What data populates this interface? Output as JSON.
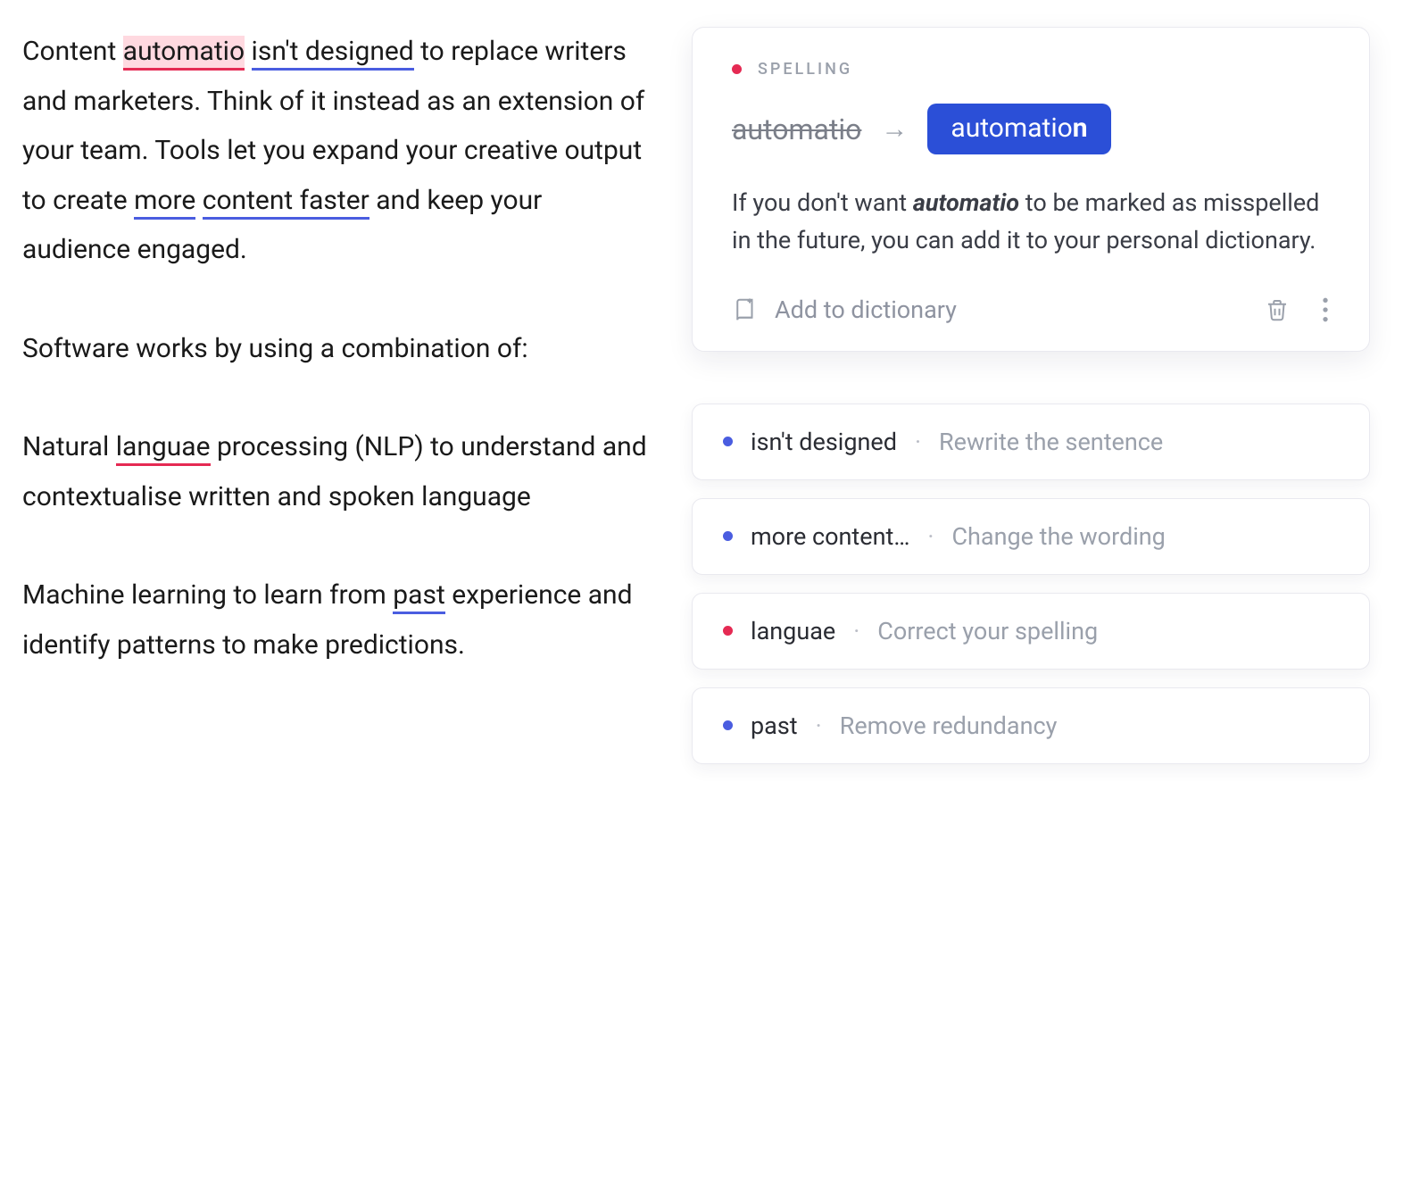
{
  "editor": {
    "p1": {
      "t1": "Content ",
      "err_automatio": "automatio",
      "space1": " ",
      "ul_isnt_designed": "isn't designed",
      "t2": " to replace writers and marketers. Think of it instead as an extension of your team. Tools let you expand your creative output to create ",
      "ul_more": "more",
      "space2": " ",
      "ul_content_faster": "content faster",
      "t3": " and keep your audience engaged."
    },
    "p2": "Software works by using a combination of:",
    "p3": {
      "t1": "Natural ",
      "err_languae": "languae",
      "t2": " processing (NLP) to understand and contextualise written and spoken language"
    },
    "p4": {
      "t1": "Machine learning to learn from ",
      "ul_past": "past",
      "t2": " experience and identify patterns to make predictions."
    }
  },
  "suggestion": {
    "category": "SPELLING",
    "wrong": "automatio",
    "fix_base": "automatio",
    "fix_bold": "n",
    "explain_pre": "If you don't want ",
    "explain_word": "automatio",
    "explain_post": " to be marked as misspelled in the future, you can add it to your personal dictionary.",
    "add_to_dict": "Add to dictionary"
  },
  "minis": [
    {
      "color": "blue",
      "term": "isn't designed",
      "hint": "Rewrite the sentence"
    },
    {
      "color": "blue",
      "term": "more content…",
      "hint": "Change the wording"
    },
    {
      "color": "red",
      "term": "languae",
      "hint": "Correct your spelling"
    },
    {
      "color": "blue",
      "term": "past",
      "hint": "Remove redundancy"
    }
  ]
}
